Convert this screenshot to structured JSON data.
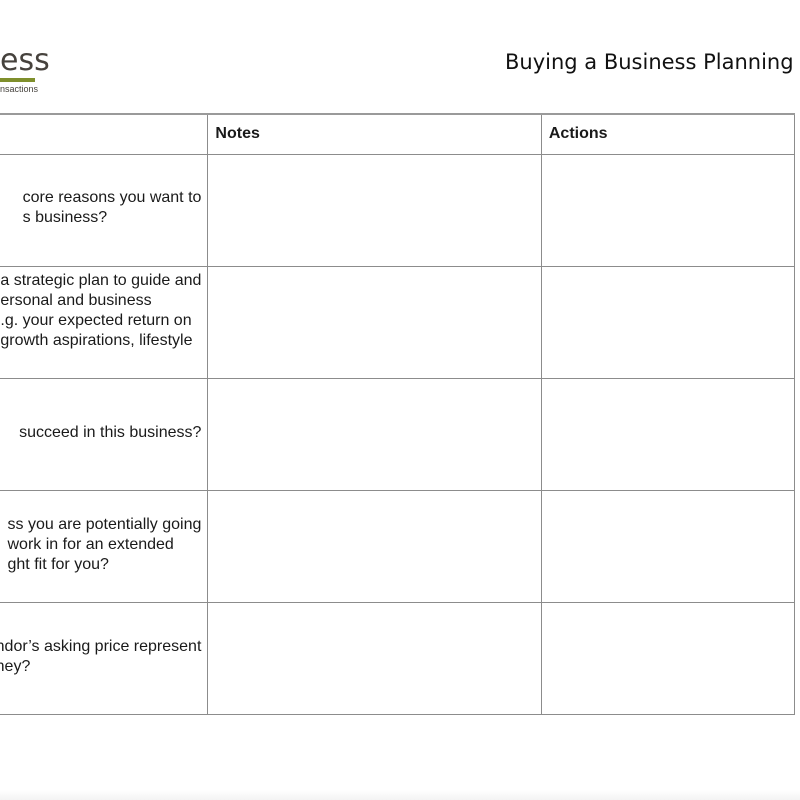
{
  "header": {
    "logo_word": "ess",
    "logo_tagline": "nsactions",
    "title": "Buying a Business Planning Sh"
  },
  "table": {
    "columns": [
      "",
      "Notes",
      "Actions"
    ],
    "rows": [
      {
        "lines": [
          "core reasons you want to",
          "s business?"
        ]
      },
      {
        "lines": [
          "a strategic plan to guide and",
          "ersonal and business",
          ".g. your expected return on",
          "growth aspirations, lifestyle"
        ]
      },
      {
        "lines": [
          "succeed in this business?"
        ]
      },
      {
        "lines": [
          "ss you are potentially going",
          "work in for an extended",
          "ght fit for you?"
        ]
      },
      {
        "lines": [
          "ndor’s asking price represent",
          "ney?"
        ]
      }
    ]
  }
}
